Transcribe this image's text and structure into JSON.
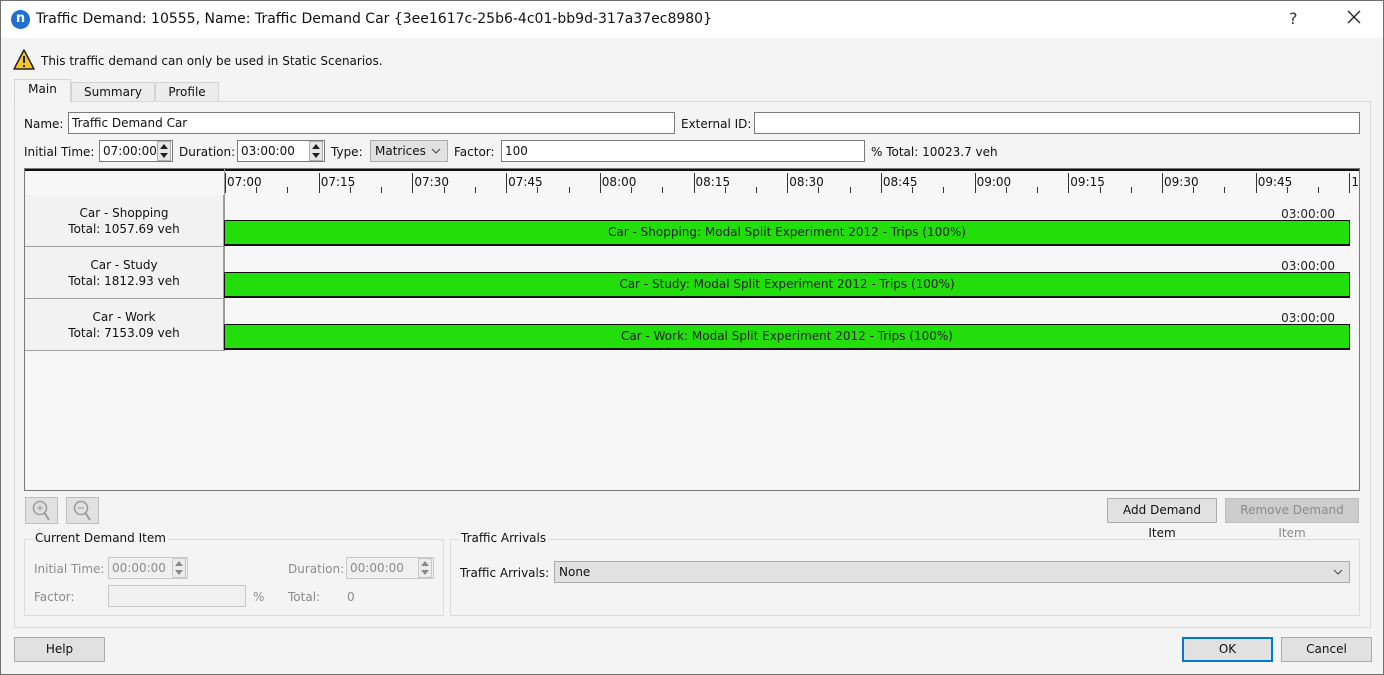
{
  "window": {
    "title": "Traffic Demand: 10555, Name: Traffic Demand Car  {3ee1617c-25b6-4c01-bb9d-317a37ec8980}",
    "app_icon_letter": "n",
    "help_glyph": "?",
    "close_glyph": "close-icon"
  },
  "warning": {
    "text": "This traffic demand can only be used in Static Scenarios.",
    "icon": "warning-icon"
  },
  "tabs": [
    {
      "label": "Main",
      "active": true
    },
    {
      "label": "Summary",
      "active": false
    },
    {
      "label": "Profile",
      "active": false
    }
  ],
  "form": {
    "name_label": "Name:",
    "name_value": "Traffic Demand Car",
    "external_id_label": "External ID:",
    "external_id_value": "",
    "initial_time_label": "Initial Time:",
    "initial_time_value": "07:00:00",
    "duration_label": "Duration:",
    "duration_value": "03:00:00",
    "type_label": "Type:",
    "type_value": "Matrices",
    "factor_label": "Factor:",
    "factor_value": "100",
    "factor_unit_total": "% Total: 10023.7 veh"
  },
  "timeline": {
    "ticks": [
      "07:00",
      "07:15",
      "07:30",
      "07:45",
      "08:00",
      "08:15",
      "08:30",
      "08:45",
      "09:00",
      "09:15",
      "09:30",
      "09:45",
      "1"
    ],
    "rows": [
      {
        "name": "Car - Shopping",
        "total": "Total: 1057.69 veh",
        "bar_label": "Car - Shopping: Modal Split Experiment 2012 - Trips (100%)",
        "duration": "03:00:00"
      },
      {
        "name": "Car - Study",
        "total": "Total: 1812.93 veh",
        "bar_label": "Car - Study: Modal Split Experiment 2012 - Trips (100%)",
        "duration": "03:00:00"
      },
      {
        "name": "Car - Work",
        "total": "Total: 7153.09 veh",
        "bar_label": "Car - Work: Modal Split Experiment 2012 - Trips (100%)",
        "duration": "03:00:00"
      }
    ],
    "bar_color": "#22df0b"
  },
  "actions": {
    "add_item": "Add Demand Item",
    "remove_item": "Remove Demand Item"
  },
  "current_item": {
    "title": "Current Demand Item",
    "initial_time_label": "Initial Time:",
    "initial_time_value": "00:00:00",
    "duration_label": "Duration:",
    "duration_value": "00:00:00",
    "factor_label": "Factor:",
    "factor_value": "",
    "factor_unit": "%",
    "total_label": "Total:",
    "total_value": "0"
  },
  "arrivals": {
    "title": "Traffic Arrivals",
    "label": "Traffic Arrivals:",
    "value": "None"
  },
  "footer": {
    "help": "Help",
    "ok": "OK",
    "cancel": "Cancel"
  },
  "colors": {
    "accent": "#0078d7",
    "bar": "#22df0b",
    "app_icon": "#1f6fd1"
  }
}
